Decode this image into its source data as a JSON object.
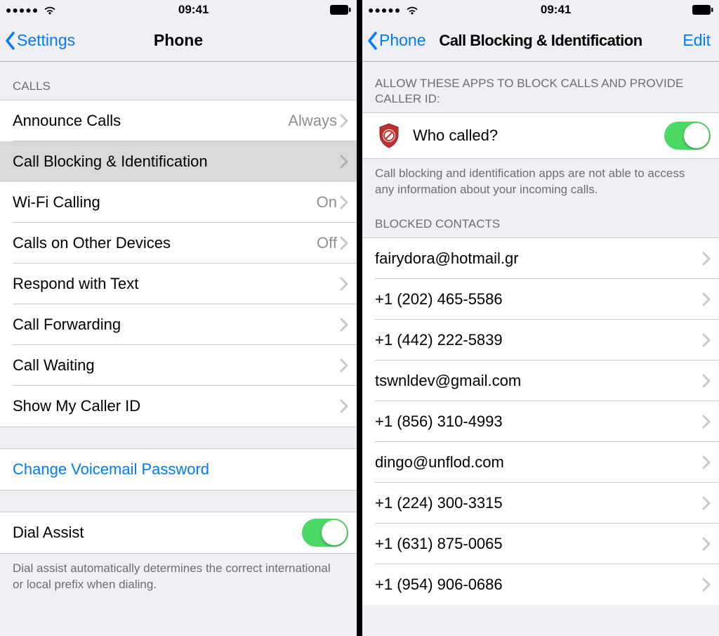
{
  "status": {
    "time": "09:41"
  },
  "left": {
    "nav": {
      "back": "Settings",
      "title": "Phone"
    },
    "sections": {
      "calls_header": "Calls",
      "rows": [
        {
          "label": "Announce Calls",
          "value": "Always"
        },
        {
          "label": "Call Blocking & Identification",
          "value": ""
        },
        {
          "label": "Wi-Fi Calling",
          "value": "On"
        },
        {
          "label": "Calls on Other Devices",
          "value": "Off"
        },
        {
          "label": "Respond with Text",
          "value": ""
        },
        {
          "label": "Call Forwarding",
          "value": ""
        },
        {
          "label": "Call Waiting",
          "value": ""
        },
        {
          "label": "Show My Caller ID",
          "value": ""
        }
      ],
      "voicemail_link": "Change Voicemail Password",
      "dial_assist_label": "Dial Assist",
      "dial_assist_footer": "Dial assist automatically determines the correct international or local prefix when dialing."
    }
  },
  "right": {
    "nav": {
      "back": "Phone",
      "title": "Call Blocking & Identification",
      "edit": "Edit"
    },
    "apps_header": "Allow these apps to block calls and provide caller ID:",
    "app_row_label": "Who called?",
    "apps_footer": "Call blocking and identification apps are not able to access any information about your incoming calls.",
    "blocked_header": "Blocked Contacts",
    "blocked": [
      "fairydora@hotmail.gr",
      "+1 (202) 465-5586",
      "+1 (442) 222-5839",
      "tswnldev@gmail.com",
      "+1 (856) 310-4993",
      "dingo@unflod.com",
      "+1 (224) 300-3315",
      "+1 (631) 875-0065",
      "+1 (954) 906-0686"
    ]
  }
}
